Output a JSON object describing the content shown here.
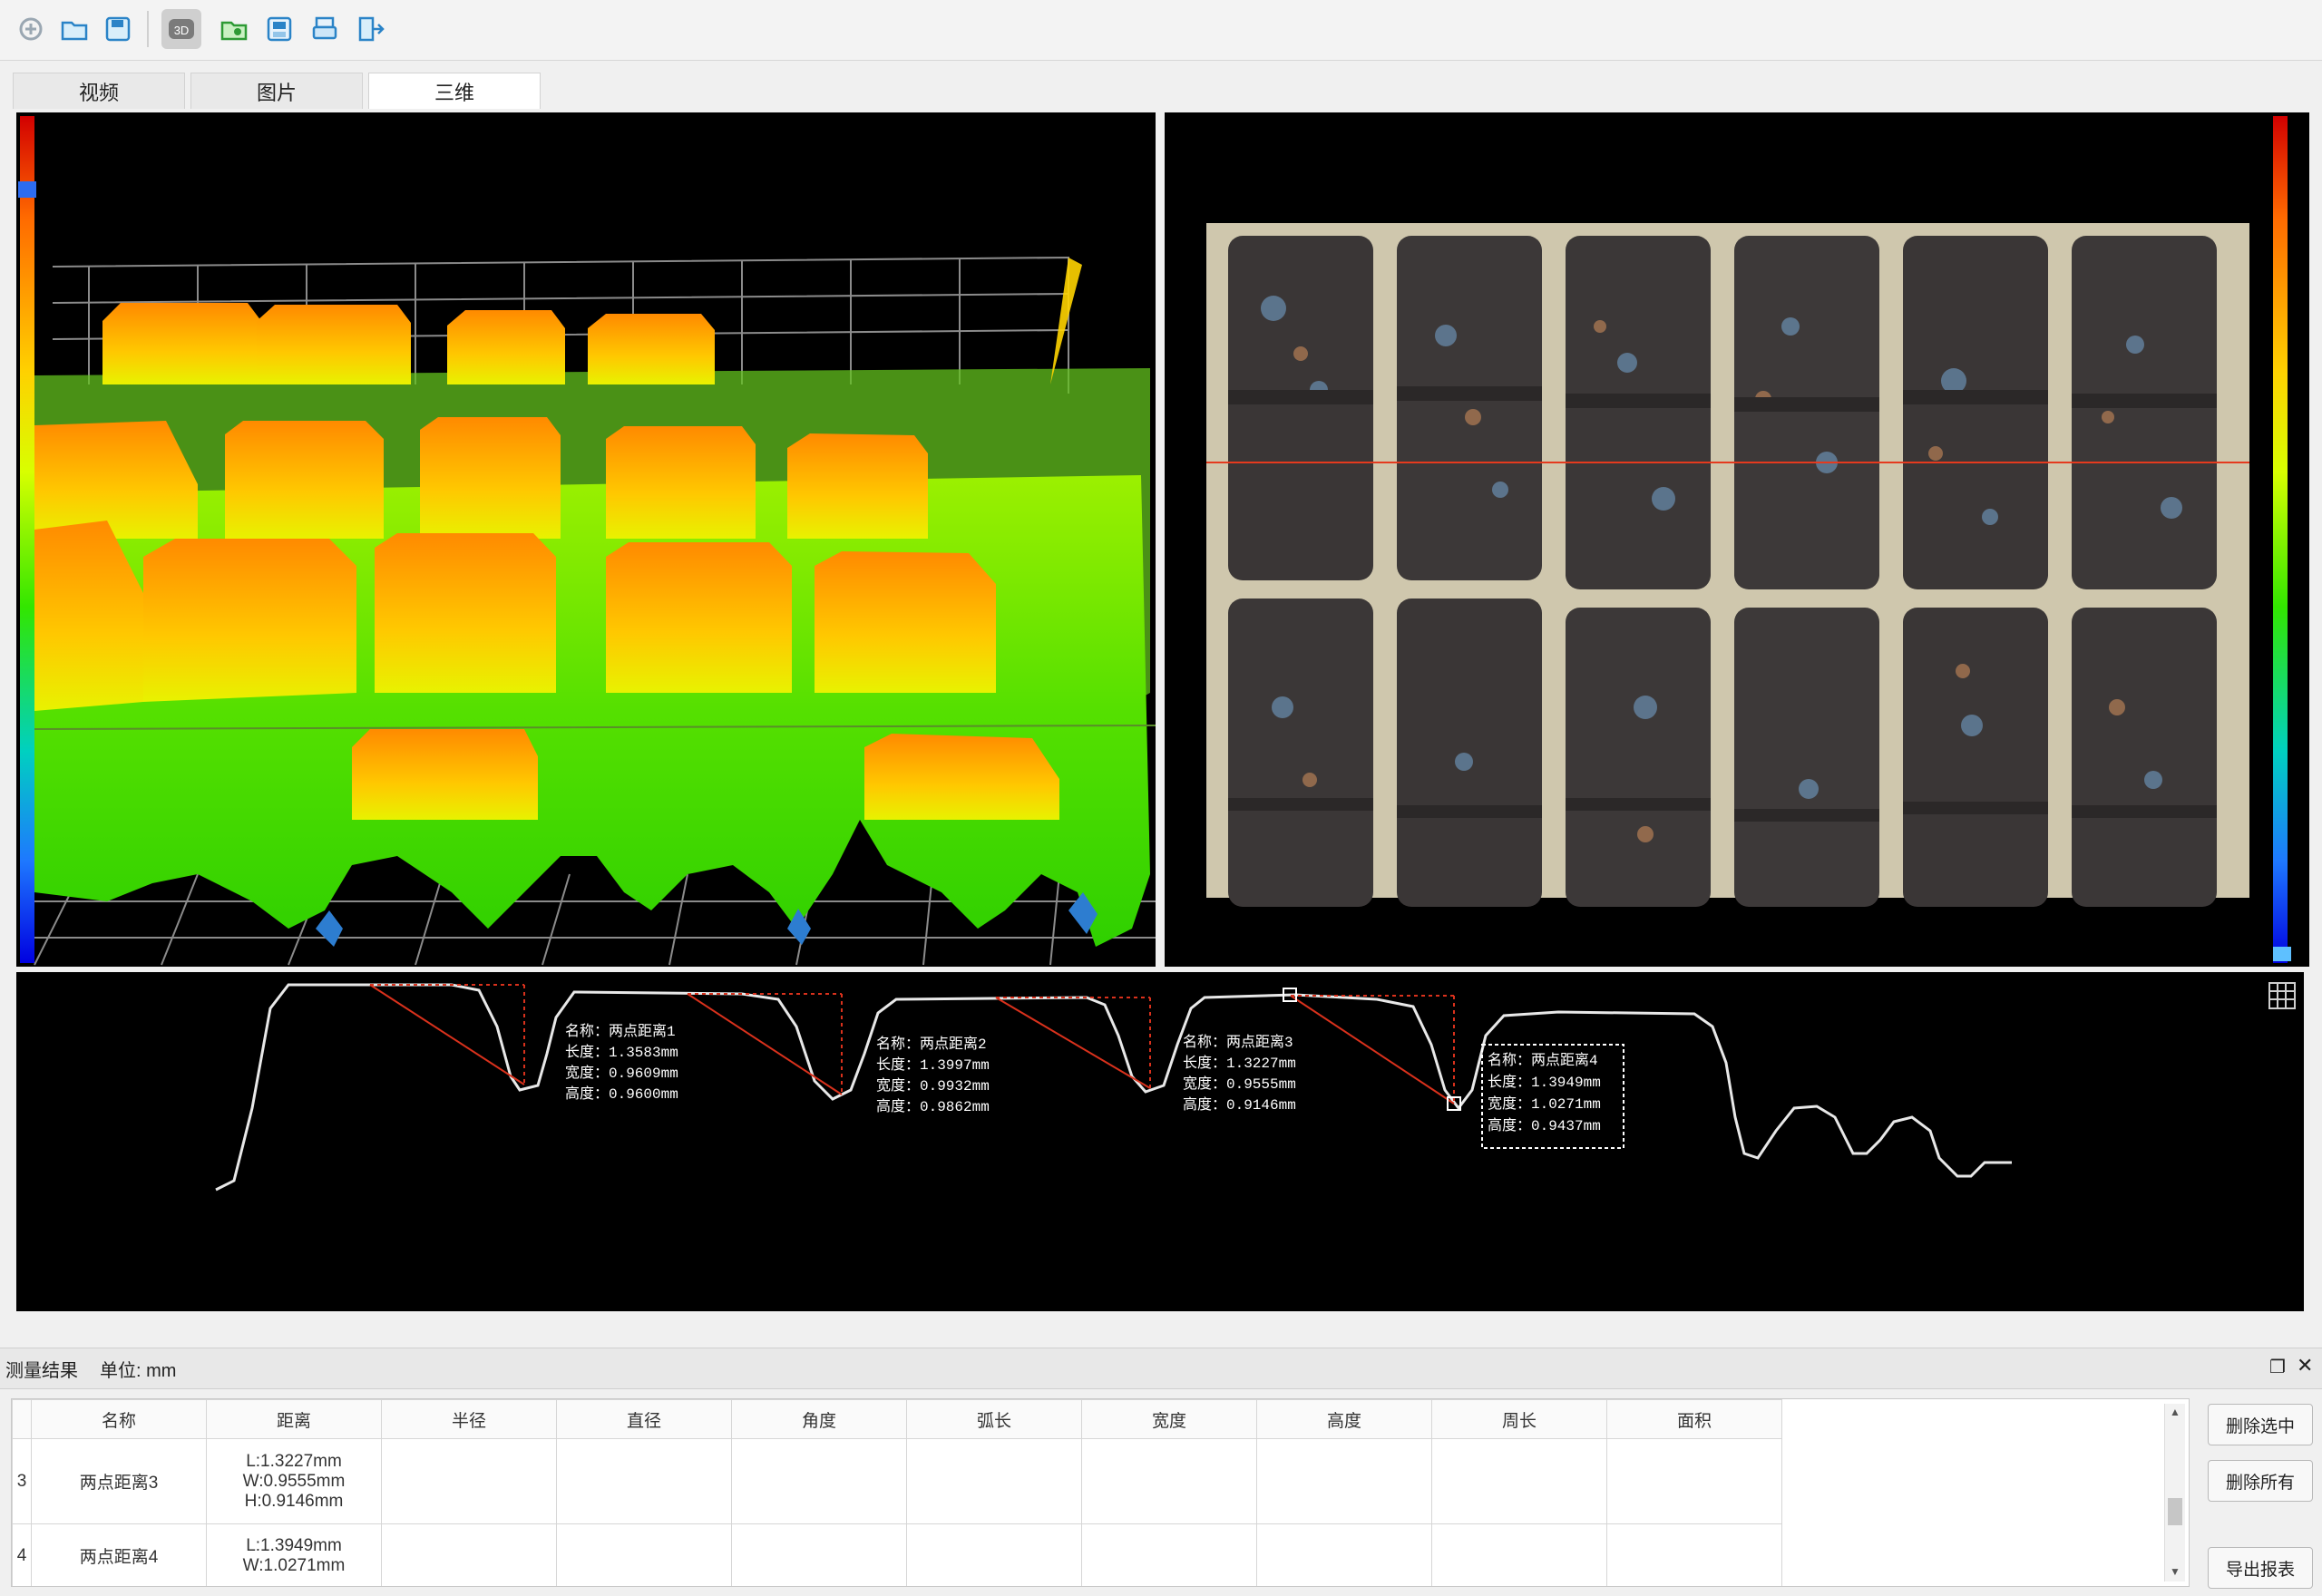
{
  "toolbar": {
    "icons": [
      "new-icon",
      "open-folder-icon",
      "save-icon",
      "3d-view-icon",
      "open-image-folder-icon",
      "save-image-icon",
      "print-icon",
      "exit-icon"
    ],
    "active_label": "3D"
  },
  "tabs": [
    {
      "label": "视频"
    },
    {
      "label": "图片"
    },
    {
      "label": "三维"
    }
  ],
  "colors": {
    "accent": "#e53a1e",
    "panel_bg": "#000000",
    "profile_line": "#e8e8e8",
    "measure_line": "#d9311c"
  },
  "profile": {
    "measurements": [
      {
        "name": "名称：两点距离1",
        "length": "长度：1.3583mm",
        "width": "宽度：0.9609mm",
        "height": "高度：0.9600mm"
      },
      {
        "name": "名称：两点距离2",
        "length": "长度：1.3997mm",
        "width": "宽度：0.9932mm",
        "height": "高度：0.9862mm"
      },
      {
        "name": "名称：两点距离3",
        "length": "长度：1.3227mm",
        "width": "宽度：0.9555mm",
        "height": "高度：0.9146mm"
      },
      {
        "name": "名称：两点距离4",
        "length": "长度：1.3949mm",
        "width": "宽度：1.0271mm",
        "height": "高度：0.9437mm"
      }
    ]
  },
  "results": {
    "title": "测量结果",
    "unit": "单位: mm",
    "columns": [
      "名称",
      "距离",
      "半径",
      "直径",
      "角度",
      "弧长",
      "宽度",
      "高度",
      "周长",
      "面积"
    ],
    "rows": [
      {
        "index": "3",
        "name": "两点距离3",
        "L": "L:1.3227mm",
        "W": "W:0.9555mm",
        "H": "H:0.9146mm"
      },
      {
        "index": "4",
        "name": "两点距离4",
        "L": "L:1.3949mm",
        "W": "W:1.0271mm"
      }
    ],
    "buttons": {
      "delete_selected": "删除选中",
      "delete_all": "删除所有",
      "export": "导出报表"
    }
  }
}
